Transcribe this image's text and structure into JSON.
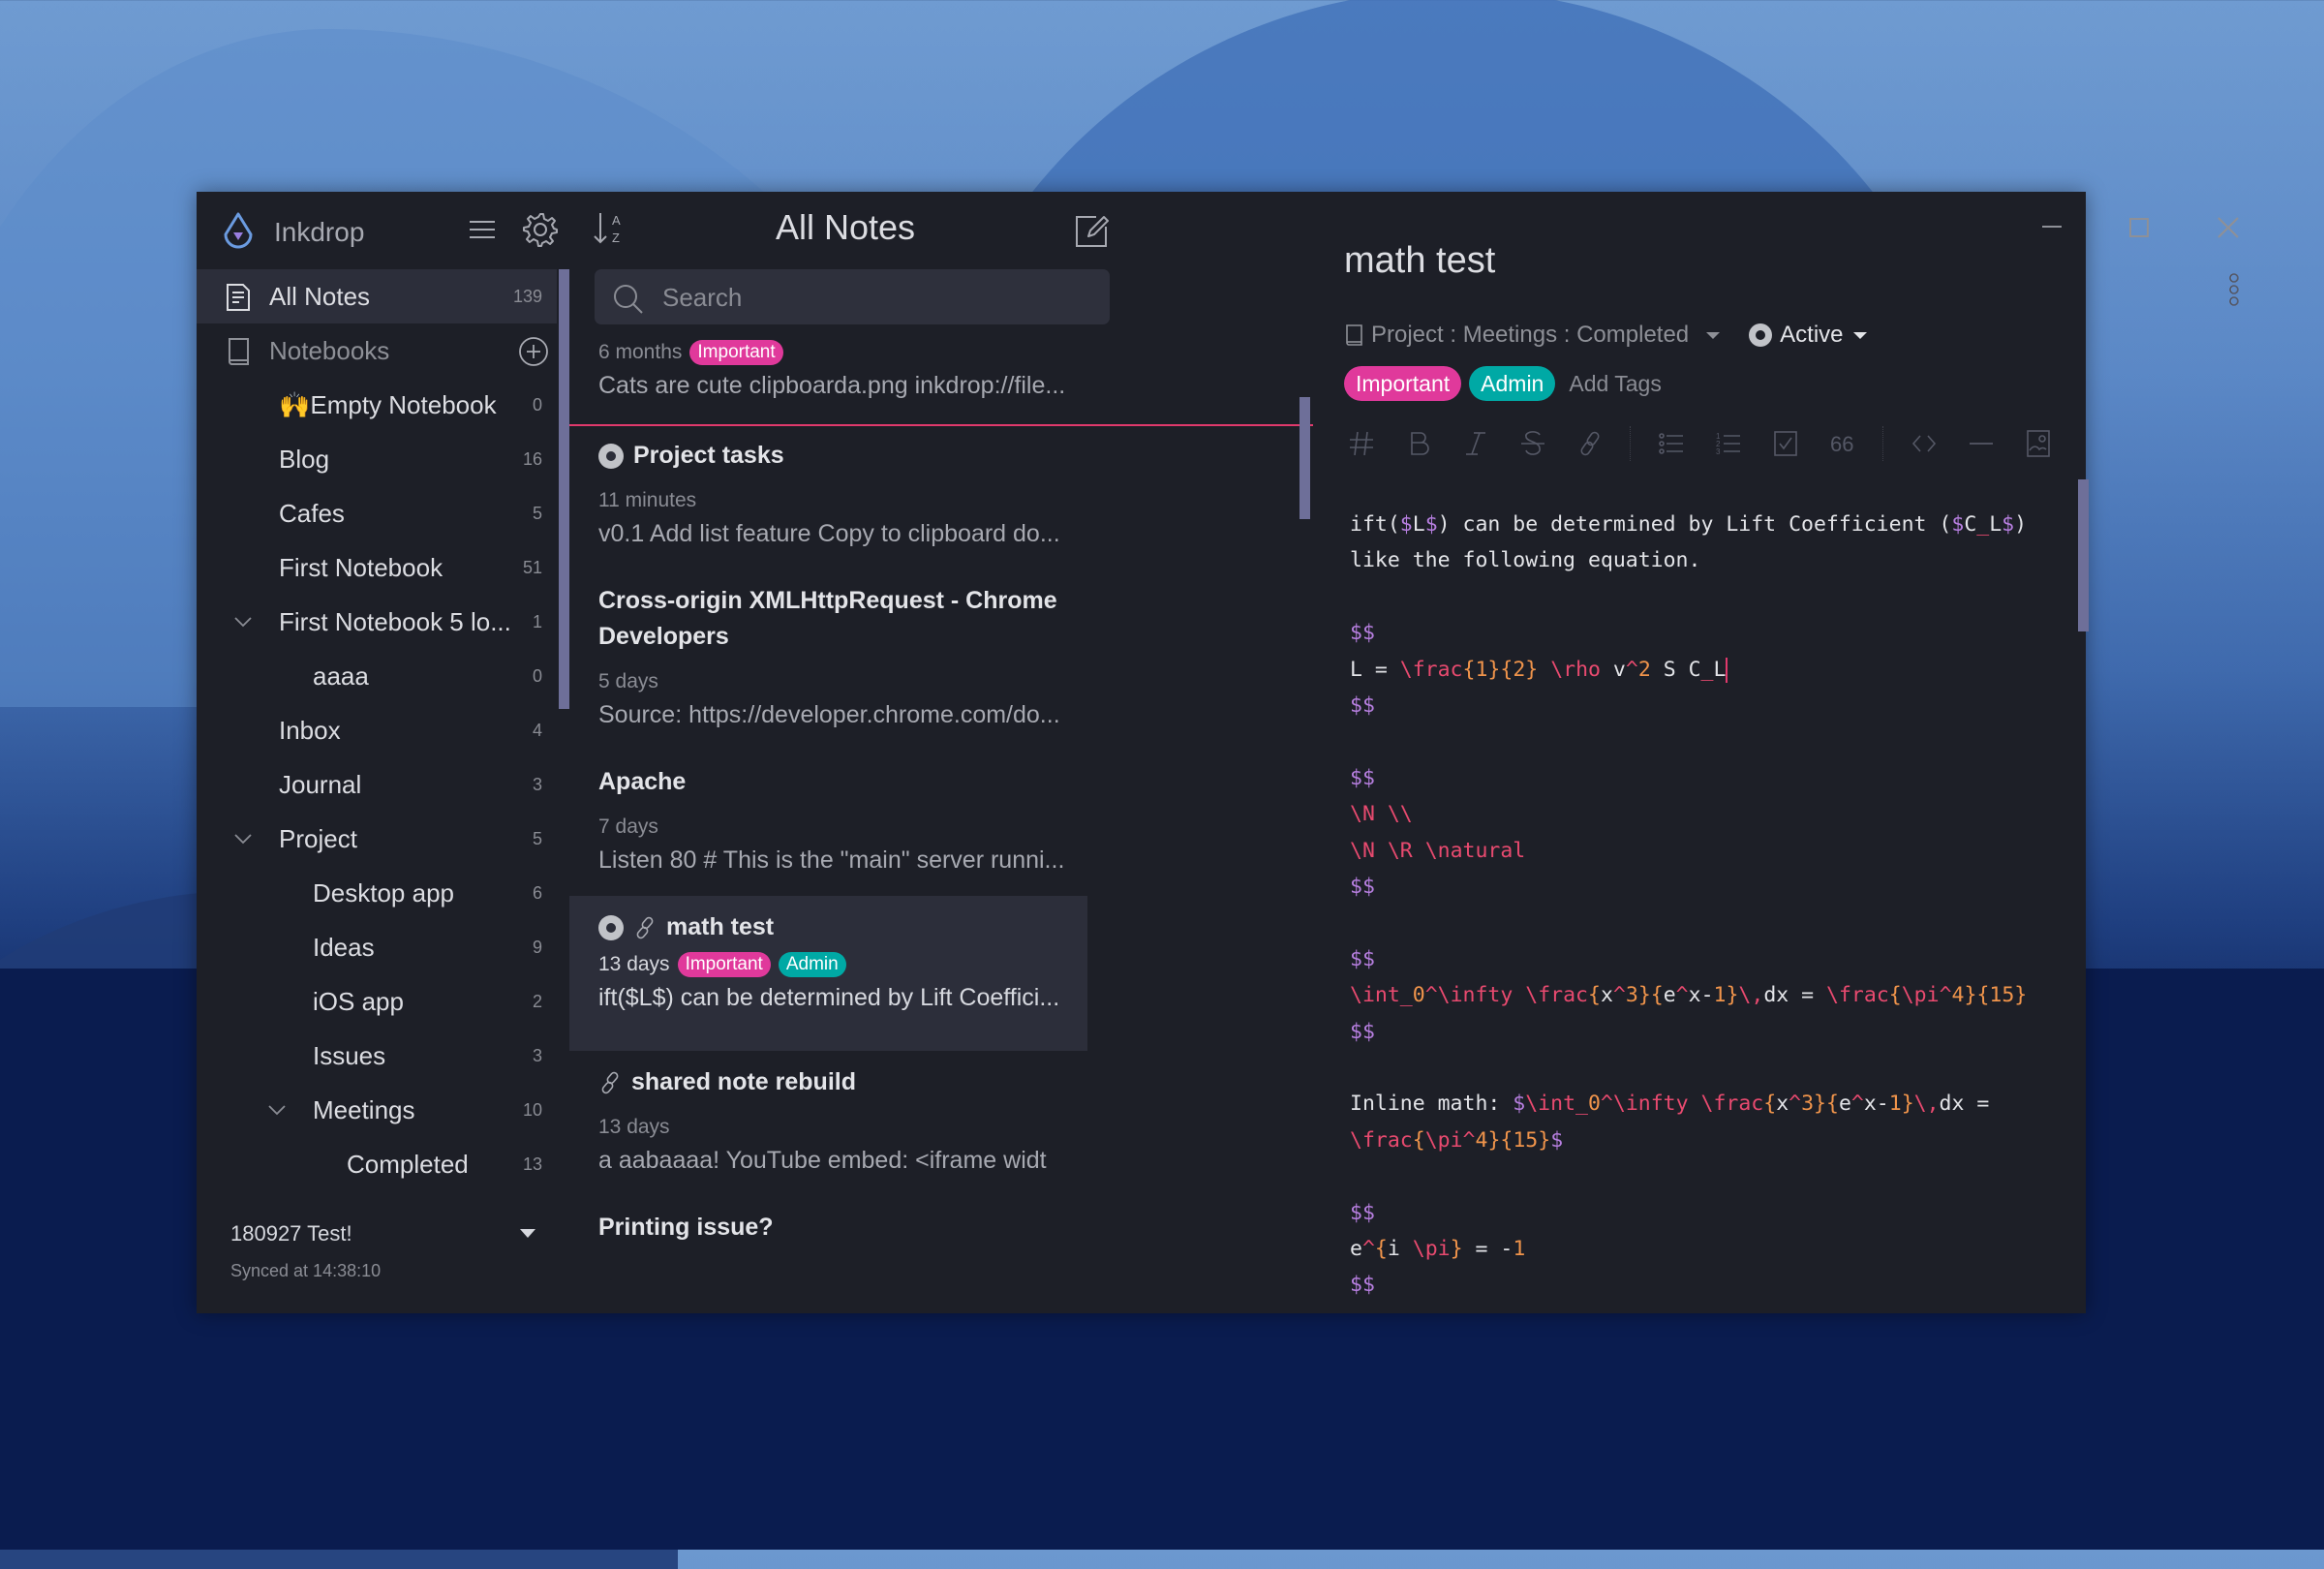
{
  "app": {
    "name": "Inkdrop"
  },
  "sidebar": {
    "all_notes": {
      "label": "All Notes",
      "count": "139"
    },
    "notebooks_header": "Notebooks",
    "items": [
      {
        "label": "🙌Empty Notebook",
        "count": "0",
        "level": 1
      },
      {
        "label": "Blog",
        "count": "16",
        "level": 1
      },
      {
        "label": "Cafes",
        "count": "5",
        "level": 1
      },
      {
        "label": "First Notebook",
        "count": "51",
        "level": 1
      },
      {
        "label": "First Notebook 5 lo...",
        "count": "1",
        "level": 1,
        "expanded": true
      },
      {
        "label": "aaaa",
        "count": "0",
        "level": 2
      },
      {
        "label": "Inbox",
        "count": "4",
        "level": 1
      },
      {
        "label": "Journal",
        "count": "3",
        "level": 1
      },
      {
        "label": "Project",
        "count": "5",
        "level": 1,
        "expanded": true
      },
      {
        "label": "Desktop app",
        "count": "6",
        "level": 2
      },
      {
        "label": "Ideas",
        "count": "9",
        "level": 2
      },
      {
        "label": "iOS app",
        "count": "2",
        "level": 2
      },
      {
        "label": "Issues",
        "count": "3",
        "level": 2
      },
      {
        "label": "Meetings",
        "count": "10",
        "level": 2,
        "expanded": true
      },
      {
        "label": "Completed",
        "count": "13",
        "level": 3
      }
    ],
    "footer": {
      "account": "180927 Test!",
      "sync_status": "Synced at 14:38:10"
    }
  },
  "notelist": {
    "title": "All Notes",
    "search_placeholder": "Search",
    "notes": [
      {
        "title": "",
        "date": "6 months",
        "tags": [
          "Important"
        ],
        "preview": "Cats are cute clipboarda.png inkdrop://file...",
        "partial": true
      },
      {
        "title": "Project tasks",
        "status": "active",
        "date": "11 minutes",
        "tags": [],
        "preview": "v0.1 Add list feature Copy to clipboard do..."
      },
      {
        "title": "Cross-origin XMLHttpRequest - Chrome Developers",
        "date": "5 days",
        "tags": [],
        "preview": "Source: https://developer.chrome.com/do..."
      },
      {
        "title": "Apache",
        "date": "7 days",
        "tags": [],
        "preview": "Listen 80 # This is the \"main\" server runni..."
      },
      {
        "title": "math test",
        "status": "active",
        "shared": true,
        "date": "13 days",
        "tags": [
          "Important",
          "Admin"
        ],
        "preview": "ift($L$) can be determined by Lift Coeffici...",
        "selected": true
      },
      {
        "title": "shared note rebuild",
        "shared": true,
        "date": "13 days",
        "tags": [],
        "preview": "a aabaaaa! YouTube embed: <iframe widt"
      },
      {
        "title": "Printing issue?",
        "date": "",
        "tags": [],
        "preview": ""
      }
    ]
  },
  "editor": {
    "title": "math test",
    "notebook_path": "Project : Meetings : Completed",
    "status": "Active",
    "tags": [
      "Important",
      "Admin"
    ],
    "add_tags_placeholder": "Add Tags",
    "toolbar": [
      "heading",
      "bold",
      "italic",
      "strikethrough",
      "link",
      "bullet-list",
      "numbered-list",
      "task-list",
      "blockquote",
      "code",
      "horizontal-rule",
      "image"
    ],
    "lines": [
      "ift($L$) can be determined by Lift Coefficient ($C_L$) like the following equation.",
      "",
      "$$",
      "L = \\frac{1}{2} \\rho v^2 S C_L",
      "$$",
      "",
      "$$",
      "\\N \\\\",
      "\\N \\R \\natural",
      "$$",
      "",
      "$$",
      "\\int_0^\\infty \\frac{x^3}{e^x-1}\\,dx = \\frac{\\pi^4}{15}",
      "$$",
      "",
      "Inline math: $\\int_0^\\infty \\frac{x^3}{e^x-1}\\,dx = \\frac{\\pi^4}{15}$",
      "",
      "$$",
      "e^{i \\pi} = -1",
      "$$"
    ]
  },
  "colors": {
    "accent_pink": "#e0399b",
    "accent_teal": "#00a9a5",
    "background": "#1d1f27",
    "selected": "#2c2e3a",
    "scrollbar": "#6e6f99",
    "math_delim": "#b77fe0",
    "math_command": "#e84a6f",
    "math_brace": "#f0944b"
  }
}
